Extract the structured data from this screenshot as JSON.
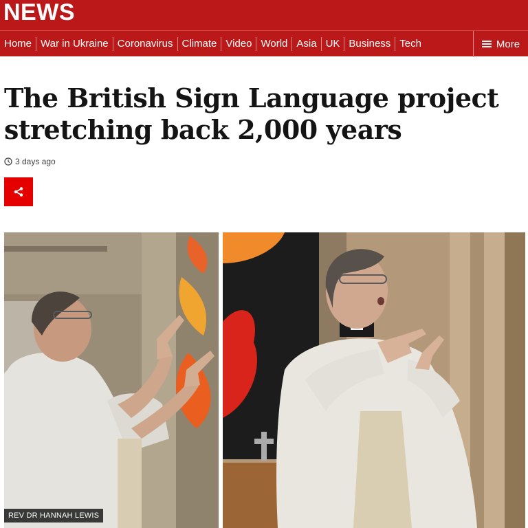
{
  "brand": {
    "name": "NEWS"
  },
  "nav": {
    "items": [
      {
        "label": "Home"
      },
      {
        "label": "War in Ukraine"
      },
      {
        "label": "Coronavirus"
      },
      {
        "label": "Climate"
      },
      {
        "label": "Video"
      },
      {
        "label": "World"
      },
      {
        "label": "Asia"
      },
      {
        "label": "UK"
      },
      {
        "label": "Business"
      },
      {
        "label": "Tech"
      }
    ],
    "more_label": "More"
  },
  "article": {
    "headline": "The British Sign Language project stretching back 2,000 years",
    "timestamp": "3 days ago",
    "image_caption": "REV DR HANNAH LEWIS"
  },
  "colors": {
    "brand_red": "#bb1919",
    "share_red": "#e50000",
    "text": "#141414"
  },
  "icons": {
    "clock": "clock-icon",
    "share": "share-icon",
    "menu": "hamburger-icon"
  }
}
